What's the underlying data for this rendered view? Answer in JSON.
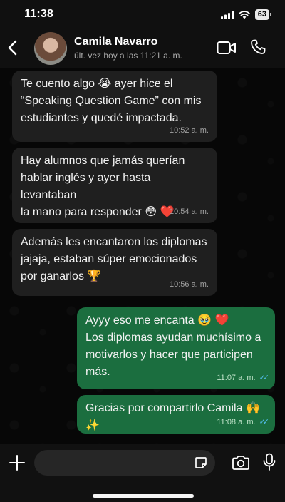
{
  "status_bar": {
    "time": "11:38",
    "battery": "63"
  },
  "header": {
    "contact_name": "Camila Navarro",
    "last_seen": "últ. vez hoy a las 11:21 a. m."
  },
  "messages": [
    {
      "direction": "incoming",
      "text": "Te cuento algo 😭 ayer hice el\n“Speaking Question Game” con mis\nestudiantes y quedé impactada.",
      "time": "10:52 a. m."
    },
    {
      "direction": "incoming",
      "text": "Hay alumnos que jamás querían\nhablar inglés y ayer hasta levantaban\nla mano para responder 😳 ❤️",
      "time": "10:54 a. m."
    },
    {
      "direction": "incoming",
      "text": "Además les encantaron los diplomas\njajaja, estaban súper emocionados\npor ganarlos 🏆",
      "time": "10:56 a. m."
    },
    {
      "direction": "outgoing",
      "text": "Ayyy eso me encanta 🥹 ❤️\nLos diplomas ayudan muchísimo a\nmotivarlos y hacer que participen\nmás.",
      "time": "11:07 a. m.",
      "read": true
    },
    {
      "direction": "outgoing",
      "text": "Gracias por compartirlo Camila 🙌✨",
      "time": "11:08 a. m.",
      "read": true
    }
  ],
  "input": {
    "value": "",
    "placeholder": ""
  },
  "colors": {
    "incoming_bubble": "#1f1f1f",
    "outgoing_bubble": "#1b6e3f",
    "read_ticks": "#53bdeb"
  },
  "icons": [
    "back-chevron-icon",
    "video-call-icon",
    "phone-icon",
    "plus-icon",
    "sticker-icon",
    "camera-icon",
    "microphone-icon"
  ]
}
